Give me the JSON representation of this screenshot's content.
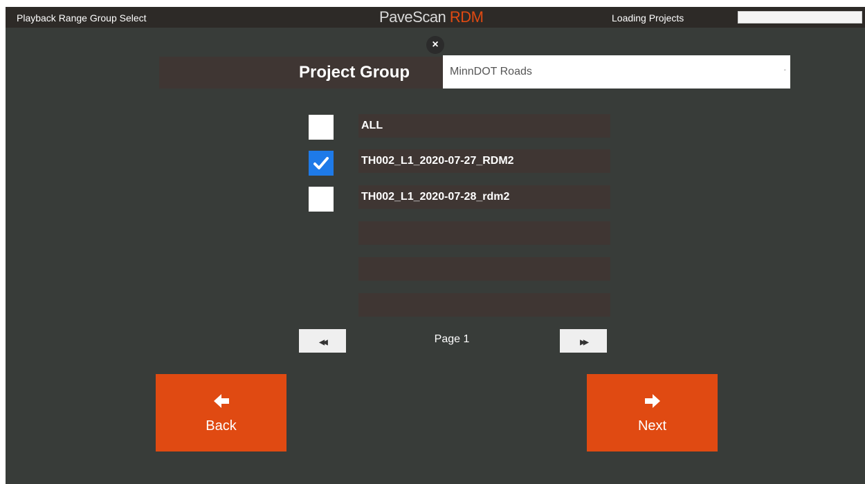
{
  "titlebar": {
    "screen_title": "Playback Range Group Select",
    "brand_main": "PaveScan ",
    "brand_accent": "RDM",
    "status_text": "Loading Projects",
    "progress_percent": 0
  },
  "dialog": {
    "close_glyph": "×",
    "project_group_label": "Project Group",
    "project_group_value": "MinnDOT Roads",
    "select_caret": "-"
  },
  "projects": [
    {
      "label": "ALL",
      "checked": false
    },
    {
      "label": "TH002_L1_2020-07-27_RDM2",
      "checked": true
    },
    {
      "label": "TH002_L1_2020-07-28_rdm2",
      "checked": false
    },
    {
      "label": "",
      "checked": false
    },
    {
      "label": "",
      "checked": false
    },
    {
      "label": "",
      "checked": false
    }
  ],
  "pagination": {
    "prev_glyph": "◀◀",
    "next_glyph": "▶▶",
    "page_label": "Page 1"
  },
  "nav": {
    "back_label": "Back",
    "next_label": "Next"
  },
  "colors": {
    "background": "#383c39",
    "accent_orange": "#e04a12",
    "checkbox_checked": "#1e7ae8",
    "row_band": "#3f3633"
  },
  "icons": {
    "close": "close-icon",
    "back": "arrow-left-icon",
    "next": "arrow-right-icon",
    "prev_page": "double-chevron-left-icon",
    "next_page": "double-chevron-right-icon",
    "check": "checkmark-icon"
  }
}
